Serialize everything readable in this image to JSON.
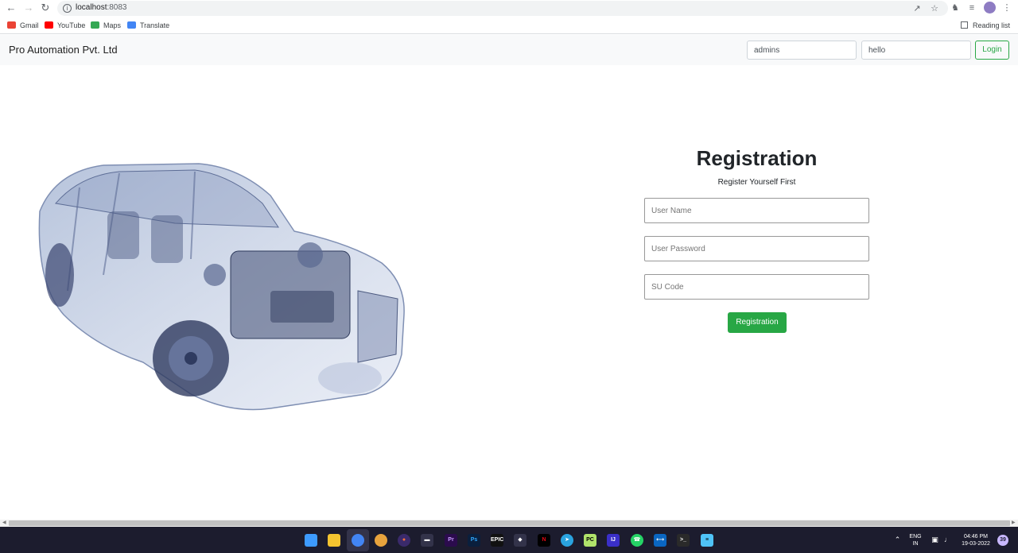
{
  "browser": {
    "url_host": "localhost",
    "url_port": ":8083",
    "bookmarks": [
      {
        "label": "Gmail",
        "color": "#ea4335"
      },
      {
        "label": "YouTube",
        "color": "#ff0000"
      },
      {
        "label": "Maps",
        "color": "#34a853"
      },
      {
        "label": "Translate",
        "color": "#4285f4"
      }
    ],
    "reading_list": "Reading list"
  },
  "navbar": {
    "brand": "Pro Automation Pvt. Ltd",
    "username_value": "admins",
    "password_value": "hello",
    "login_label": "Login"
  },
  "registration": {
    "title": "Registration",
    "subtitle": "Register Yourself First",
    "username_placeholder": "User Name",
    "password_placeholder": "User Password",
    "su_code_placeholder": "SU Code",
    "submit_label": "Registration"
  },
  "taskbar": {
    "language_top": "ENG",
    "language_bottom": "IN",
    "time": "04:46 PM",
    "date": "19-03-2022",
    "notification_count": "39"
  },
  "colors": {
    "accent_green": "#28a745",
    "navbar_bg": "#f8f9fa"
  }
}
